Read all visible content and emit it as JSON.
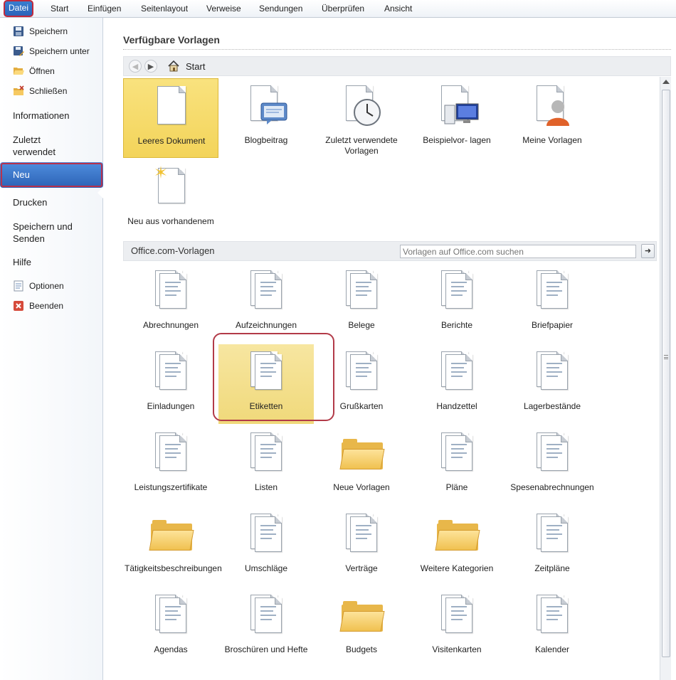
{
  "ribbon": {
    "tabs": [
      "Datei",
      "Start",
      "Einfügen",
      "Seitenlayout",
      "Verweise",
      "Sendungen",
      "Überprüfen",
      "Ansicht"
    ]
  },
  "sidebar": {
    "save": "Speichern",
    "save_as": "Speichern unter",
    "open": "Öffnen",
    "close": "Schließen",
    "info": "Informationen",
    "recent": "Zuletzt verwendet",
    "new": "Neu",
    "print": "Drucken",
    "save_send": "Speichern und Senden",
    "help": "Hilfe",
    "options": "Optionen",
    "exit": "Beenden"
  },
  "main": {
    "heading": "Verfügbare Vorlagen",
    "breadcrumb": "Start",
    "available": [
      {
        "label": "Leeres Dokument",
        "icon": "blank-document-icon"
      },
      {
        "label": "Blogbeitrag",
        "icon": "blog-post-icon"
      },
      {
        "label": "Zuletzt verwendete Vorlagen",
        "icon": "recent-templates-icon"
      },
      {
        "label": "Beispielvor- lagen",
        "icon": "sample-templates-icon"
      },
      {
        "label": "Meine Vorlagen",
        "icon": "my-templates-icon"
      },
      {
        "label": "Neu aus vorhandenem",
        "icon": "new-from-existing-icon"
      }
    ],
    "office_title": "Office.com-Vorlagen",
    "search_placeholder": "Vorlagen auf Office.com suchen",
    "office": [
      {
        "label": "Abrechnungen",
        "icon": "invoice-doc-icon"
      },
      {
        "label": "Aufzeichnungen",
        "icon": "records-doc-icon"
      },
      {
        "label": "Belege",
        "icon": "receipt-doc-icon"
      },
      {
        "label": "Berichte",
        "icon": "report-doc-icon"
      },
      {
        "label": "Briefpapier",
        "icon": "letterhead-doc-icon"
      },
      {
        "label": "Einladungen",
        "icon": "invitation-doc-icon"
      },
      {
        "label": "Etiketten",
        "icon": "labels-doc-icon"
      },
      {
        "label": "Grußkarten",
        "icon": "greeting-card-doc-icon"
      },
      {
        "label": "Handzettel",
        "icon": "flyer-doc-icon"
      },
      {
        "label": "Lagerbestände",
        "icon": "inventory-doc-icon"
      },
      {
        "label": "Leistungszertifikate",
        "icon": "certificate-doc-icon"
      },
      {
        "label": "Listen",
        "icon": "checklist-doc-icon"
      },
      {
        "label": "Neue Vorlagen",
        "icon": "folder-icon"
      },
      {
        "label": "Pläne",
        "icon": "plans-doc-icon"
      },
      {
        "label": "Spesenabrechnungen",
        "icon": "expense-doc-icon"
      },
      {
        "label": "Tätigkeitsbeschreibungen",
        "icon": "folder-icon"
      },
      {
        "label": "Umschläge",
        "icon": "envelope-doc-icon"
      },
      {
        "label": "Verträge",
        "icon": "contract-doc-icon"
      },
      {
        "label": "Weitere Kategorien",
        "icon": "folder-icon"
      },
      {
        "label": "Zeitpläne",
        "icon": "schedule-doc-icon"
      },
      {
        "label": "Agendas",
        "icon": "agenda-doc-icon"
      },
      {
        "label": "Broschüren und Hefte",
        "icon": "brochure-doc-icon"
      },
      {
        "label": "Budgets",
        "icon": "folder-icon"
      },
      {
        "label": "Visitenkarten",
        "icon": "business-card-doc-icon"
      },
      {
        "label": "Kalender",
        "icon": "calendar-doc-icon"
      }
    ]
  },
  "colors": {
    "accent": "#2c62b5",
    "selected": "#f3d45a",
    "highlight_ring": "#b23a48"
  }
}
